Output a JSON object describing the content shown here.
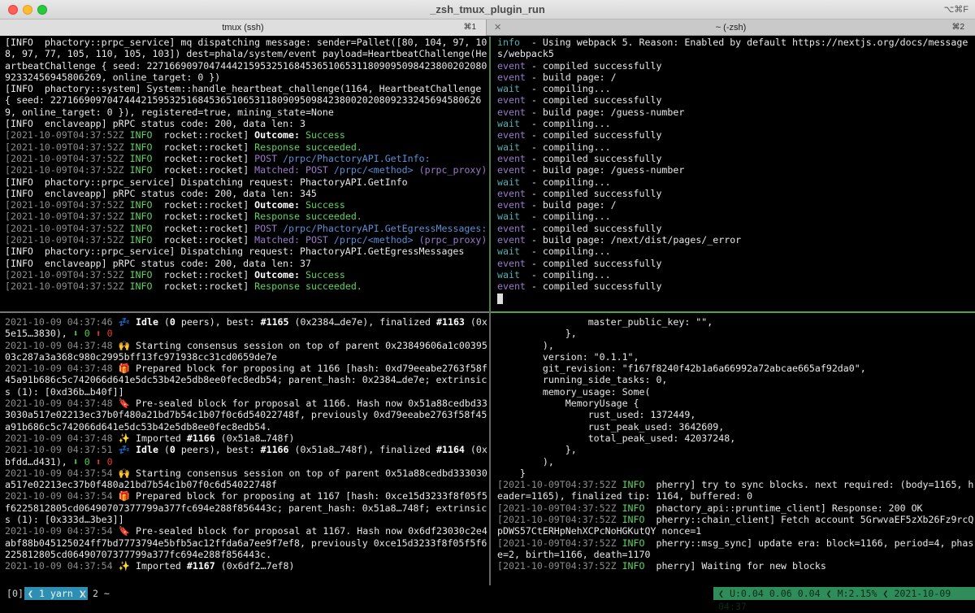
{
  "window": {
    "title": "_zsh_tmux_plugin_run",
    "shortcut": "⌥⌘F"
  },
  "tabs": [
    {
      "label": "tmux (ssh)",
      "shortcut": "⌘1",
      "active": true
    },
    {
      "label": "~ (-zsh)",
      "shortcut": "⌘2",
      "active": false
    }
  ],
  "pane_top_left": [
    "[INFO  phactory::prpc_service] mq dispatching message: sender=Pallet([80, 104, 97, 108, 97, 77, 105, 110, 105, 103]) dest=phala/system/event payload=HeartbeatChallenge(HeartbeatChallenge { seed: 22716690970474442159532516845365106531180909509842380020208092332456945806269, online_target: 0 })",
    "[INFO  phactory::system] System::handle_heartbeat_challenge(1164, HeartbeatChallenge { seed: 22716690970474442159532516845365106531180909509842380020208092332456945806269, online_target: 0 }), registered=true, mining_state=None",
    "[INFO  enclaveapp] pRPC status code: 200, data len: 3",
    {
      "ts": "[2021-10-09T04:37:52Z",
      "lvl": "INFO",
      "src": "rocket::rocket]",
      "kw": "Outcome:",
      "msg": "Success"
    },
    {
      "ts": "[2021-10-09T04:37:52Z",
      "lvl": "INFO",
      "src": "rocket::rocket]",
      "msg": "Response succeeded."
    },
    {
      "ts": "[2021-10-09T04:37:52Z",
      "lvl": "INFO",
      "src": "rocket::rocket]",
      "kw": "POST",
      "msg": "/prpc/PhactoryAPI.GetInfo:"
    },
    {
      "ts": "[2021-10-09T04:37:52Z",
      "lvl": "INFO",
      "src": "rocket::rocket]",
      "kw": "Matched: POST",
      "msg": "/prpc/<method>",
      "extra": "(prpc_proxy)"
    },
    "[INFO  phactory::prpc_service] Dispatching request: PhactoryAPI.GetInfo",
    "[INFO  enclaveapp] pRPC status code: 200, data len: 345",
    {
      "ts": "[2021-10-09T04:37:52Z",
      "lvl": "INFO",
      "src": "rocket::rocket]",
      "kw": "Outcome:",
      "msg": "Success"
    },
    {
      "ts": "[2021-10-09T04:37:52Z",
      "lvl": "INFO",
      "src": "rocket::rocket]",
      "msg": "Response succeeded."
    },
    {
      "ts": "[2021-10-09T04:37:52Z",
      "lvl": "INFO",
      "src": "rocket::rocket]",
      "kw": "POST",
      "msg": "/prpc/PhactoryAPI.GetEgressMessages:"
    },
    {
      "ts": "[2021-10-09T04:37:52Z",
      "lvl": "INFO",
      "src": "rocket::rocket]",
      "kw": "Matched: POST",
      "msg": "/prpc/<method>",
      "extra": "(prpc_proxy)"
    },
    "[INFO  phactory::prpc_service] Dispatching request: PhactoryAPI.GetEgressMessages",
    "[INFO  enclaveapp] pRPC status code: 200, data len: 37",
    {
      "ts": "[2021-10-09T04:37:52Z",
      "lvl": "INFO",
      "src": "rocket::rocket]",
      "kw": "Outcome:",
      "msg": "Success"
    },
    {
      "ts": "[2021-10-09T04:37:52Z",
      "lvl": "INFO",
      "src": "rocket::rocket]",
      "msg": "Response succeeded."
    }
  ],
  "pane_top_right": [
    {
      "tag": "info",
      "dash": "  -",
      "msg": " Using webpack 5. Reason: Enabled by default https://nextjs.org/docs/messages/webpack5"
    },
    {
      "tag": "event",
      "dash": " -",
      "msg": " compiled successfully"
    },
    {
      "tag": "event",
      "dash": " -",
      "msg": " build page: /"
    },
    {
      "tag": "wait",
      "dash": "  -",
      "msg": " compiling..."
    },
    {
      "tag": "event",
      "dash": " -",
      "msg": " compiled successfully"
    },
    {
      "tag": "event",
      "dash": " -",
      "msg": " build page: /guess-number"
    },
    {
      "tag": "wait",
      "dash": "  -",
      "msg": " compiling..."
    },
    {
      "tag": "event",
      "dash": " -",
      "msg": " compiled successfully"
    },
    {
      "tag": "wait",
      "dash": "  -",
      "msg": " compiling..."
    },
    {
      "tag": "event",
      "dash": " -",
      "msg": " compiled successfully"
    },
    {
      "tag": "event",
      "dash": " -",
      "msg": " build page: /guess-number"
    },
    {
      "tag": "wait",
      "dash": "  -",
      "msg": " compiling..."
    },
    {
      "tag": "event",
      "dash": " -",
      "msg": " compiled successfully"
    },
    {
      "tag": "event",
      "dash": " -",
      "msg": " build page: /"
    },
    {
      "tag": "wait",
      "dash": "  -",
      "msg": " compiling..."
    },
    {
      "tag": "event",
      "dash": " -",
      "msg": " compiled successfully"
    },
    {
      "tag": "event",
      "dash": " -",
      "msg": " build page: /next/dist/pages/_error"
    },
    {
      "tag": "wait",
      "dash": "  -",
      "msg": " compiling..."
    },
    {
      "tag": "event",
      "dash": " -",
      "msg": " compiled successfully"
    },
    {
      "tag": "wait",
      "dash": "  -",
      "msg": " compiling..."
    },
    {
      "tag": "event",
      "dash": " -",
      "msg": " compiled successfully"
    }
  ],
  "pane_bottom_left": [
    {
      "ts": "2021-10-09 04:37:46",
      "icon": "💤",
      "parts": [
        [
          "b",
          "Idle"
        ],
        [
          "n",
          " ("
        ],
        [
          "b",
          "0"
        ],
        [
          "n",
          " peers), best: "
        ],
        [
          "b",
          "#1165"
        ],
        [
          "n",
          " (0x2384…de7e), finalized "
        ],
        [
          "b",
          "#1163"
        ],
        [
          "n",
          " (0x5e15…3830), "
        ],
        [
          "dl",
          "⬇ 0 "
        ],
        [
          "ul",
          "⬆ 0"
        ]
      ]
    },
    {
      "ts": "2021-10-09 04:37:48",
      "icon": "🙌",
      "parts": [
        [
          "n",
          "Starting consensus session on top of parent 0x23849606a1c0039503c287a3a368c980c2995bff13fc971938cc31cd0659de7e"
        ]
      ]
    },
    {
      "ts": "2021-10-09 04:37:48",
      "icon": "🎁",
      "parts": [
        [
          "n",
          "Prepared block for proposing at 1166 [hash: 0xd79eeabe2763f58f45a91b686c5c742066d641e5dc53b42e5db8ee0fec8edb54; parent_hash: 0x2384…de7e; extrinsics (1): [0xd36b…b40f]]"
        ]
      ]
    },
    {
      "ts": "2021-10-09 04:37:48",
      "icon": "🔖",
      "parts": [
        [
          "n",
          "Pre-sealed block for proposal at 1166. Hash now 0x51a88cedbd333030a517e02213ec37b0f480a21bd7b54c1b07f0c6d54022748f, previously 0xd79eeabe2763f58f45a91b686c5c742066d641e5dc53b42e5db8ee0fec8edb54."
        ]
      ]
    },
    {
      "ts": "2021-10-09 04:37:48",
      "icon": "✨",
      "parts": [
        [
          "n",
          "Imported "
        ],
        [
          "b",
          "#1166"
        ],
        [
          "n",
          " (0x51a8…748f)"
        ]
      ]
    },
    {
      "ts": "2021-10-09 04:37:51",
      "icon": "💤",
      "parts": [
        [
          "b",
          "Idle"
        ],
        [
          "n",
          " ("
        ],
        [
          "b",
          "0"
        ],
        [
          "n",
          " peers), best: "
        ],
        [
          "b",
          "#1166"
        ],
        [
          "n",
          " (0x51a8…748f), finalized "
        ],
        [
          "b",
          "#1164"
        ],
        [
          "n",
          " (0xbfdd…d431), "
        ],
        [
          "dl",
          "⬇ 0 "
        ],
        [
          "ul",
          "⬆ 0"
        ]
      ]
    },
    {
      "ts": "2021-10-09 04:37:54",
      "icon": "🙌",
      "parts": [
        [
          "n",
          "Starting consensus session on top of parent 0x51a88cedbd333030a517e02213ec37b0f480a21bd7b54c1b07f0c6d54022748f"
        ]
      ]
    },
    {
      "ts": "2021-10-09 04:37:54",
      "icon": "🎁",
      "parts": [
        [
          "n",
          "Prepared block for proposing at 1167 [hash: 0xce15d3233f8f05f5f6225812805cd06490707377799a377fc694e288f856443c; parent_hash: 0x51a8…748f; extrinsics (1): [0x333d…3be3]]"
        ]
      ]
    },
    {
      "ts": "2021-10-09 04:37:54",
      "icon": "🔖",
      "parts": [
        [
          "n",
          "Pre-sealed block for proposal at 1167. Hash now 0x6df23030c2e4abf88b045125024ff7bd7773794e5bfb5ac12ffda6a7ee9f7ef8, previously 0xce15d3233f8f05f5f6225812805cd06490707377799a377fc694e288f856443c."
        ]
      ]
    },
    {
      "ts": "2021-10-09 04:37:54",
      "icon": "✨",
      "parts": [
        [
          "n",
          "Imported "
        ],
        [
          "b",
          "#1167"
        ],
        [
          "n",
          " (0x6df2…7ef8)"
        ]
      ]
    }
  ],
  "pane_bottom_right": [
    {
      "raw": "                master_public_key: \"\","
    },
    {
      "raw": "            },"
    },
    {
      "raw": "        ),"
    },
    {
      "raw": "        version: \"0.1.1\","
    },
    {
      "raw": "        git_revision: \"f167f8240f42b1a6a66992a72abcae665af92da0\","
    },
    {
      "raw": "        running_side_tasks: 0,"
    },
    {
      "raw": "        memory_usage: Some("
    },
    {
      "raw": "            MemoryUsage {"
    },
    {
      "raw": "                rust_used: 1372449,"
    },
    {
      "raw": "                rust_peak_used: 3642609,"
    },
    {
      "raw": "                total_peak_used: 42037248,"
    },
    {
      "raw": "            },"
    },
    {
      "raw": "        ),"
    },
    {
      "raw": "    }"
    },
    {
      "ts": "[2021-10-09T04:37:52Z",
      "lvl": "INFO",
      "src": "pherry]",
      "msg": "try to sync blocks. next required: (body=1165, header=1165), finalized tip: 1164, buffered: 0"
    },
    {
      "ts": "[2021-10-09T04:37:52Z",
      "lvl": "INFO",
      "src": "phactory_api::pruntime_client]",
      "msg": "Response: 200 OK"
    },
    {
      "ts": "[2021-10-09T04:37:52Z",
      "lvl": "INFO",
      "src": "pherry::chain_client]",
      "msg": "Fetch account 5GrwvaEF5zXb26Fz9rcQpDWS57CtERHpNehXCPcNoHGKutQY nonce=1"
    },
    {
      "ts": "[2021-10-09T04:37:52Z",
      "lvl": "INFO",
      "src": "pherry::msg_sync]",
      "msg": "update era: block=1166, period=4, phase=2, birth=1166, death=1170"
    },
    {
      "ts": "[2021-10-09T04:37:52Z",
      "lvl": "INFO",
      "src": "pherry]",
      "msg": "Waiting for new blocks"
    }
  ],
  "statusbar": {
    "session": "[0]",
    "window1": "❮ 1 yarn ❯",
    "window2": "❮ 2 ~",
    "right": "❮ U:0.04 0.06 0.04 ❮ M:2.15% ❮ 2021-10-09 04:37"
  },
  "colors": {
    "accent_green": "#4aa84a",
    "tmux_window_active": "#2e8fb3",
    "status_right_bg": "#2f8d5a"
  }
}
